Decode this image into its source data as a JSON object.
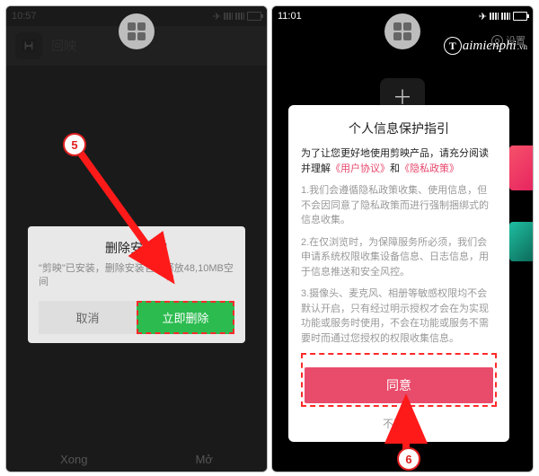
{
  "left": {
    "time": "10:57",
    "app_title": "回映",
    "dialog": {
      "title": "删除安装包",
      "message": "\"剪映\"已安装，删除安装包可释放48,10MB空间",
      "cancel": "取消",
      "confirm": "立即删除"
    },
    "bottom": {
      "a": "Xong",
      "b": "Mở"
    }
  },
  "right": {
    "time": "11:01",
    "settings_label": "设置",
    "dialog": {
      "title": "个人信息保护指引",
      "intro_prefix": "为了让您更好地使用剪映产品，请充分阅读并理解",
      "link1": "《用户协议》",
      "intro_mid": "和",
      "link2": "《隐私政策》",
      "p1": "1.我们会遵循隐私政策收集、使用信息，但不会因同意了隐私政策而进行强制捆绑式的信息收集。",
      "p2": "2.在仅浏览时，为保障服务所必须，我们会申请系统权限收集设备信息、日志信息，用于信息推送和安全风控。",
      "p3": "3.摄像头、麦克风、相册等敏感权限均不会默认开启，只有经过明示授权才会在为实现功能或服务时使用，不会在功能或服务不需要时而通过您授权的权限收集信息。",
      "agree": "同意",
      "disagree": "不同意"
    }
  },
  "watermark": {
    "brand": "aimienphi",
    "suffix": ".vn"
  },
  "callouts": {
    "five": "5",
    "six": "6"
  }
}
